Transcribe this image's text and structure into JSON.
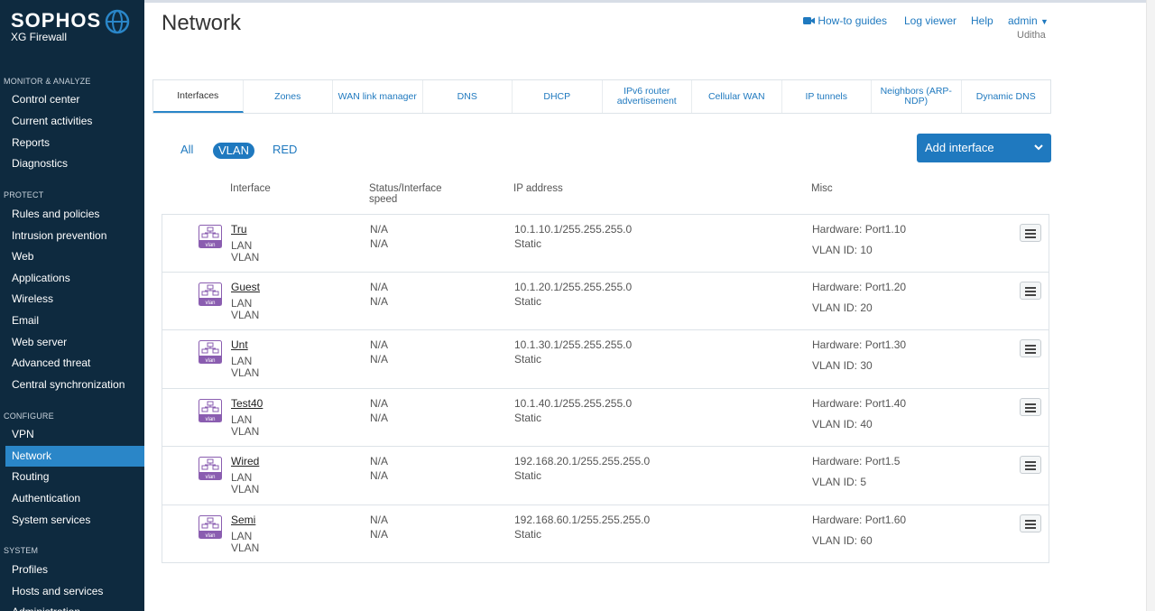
{
  "brand": {
    "name": "SOPHOS",
    "product": "XG Firewall"
  },
  "sidebar": {
    "sections": [
      {
        "label": "MONITOR & ANALYZE",
        "items": [
          "Control center",
          "Current activities",
          "Reports",
          "Diagnostics"
        ]
      },
      {
        "label": "PROTECT",
        "items": [
          "Rules and policies",
          "Intrusion prevention",
          "Web",
          "Applications",
          "Wireless",
          "Email",
          "Web server",
          "Advanced threat",
          "Central synchronization"
        ]
      },
      {
        "label": "CONFIGURE",
        "items": [
          "VPN",
          "Network",
          "Routing",
          "Authentication",
          "System services"
        ]
      },
      {
        "label": "SYSTEM",
        "items": [
          "Profiles",
          "Hosts and services",
          "Administration"
        ]
      }
    ],
    "active_item": "Network"
  },
  "header": {
    "title": "Network",
    "links": {
      "guides": "How-to guides",
      "log": "Log viewer",
      "help": "Help",
      "admin": "admin"
    },
    "user": "Uditha"
  },
  "tabs": [
    "Interfaces",
    "Zones",
    "WAN link manager",
    "DNS",
    "DHCP",
    "IPv6 router advertisement",
    "Cellular WAN",
    "IP tunnels",
    "Neighbors (ARP-NDP)",
    "Dynamic DNS"
  ],
  "active_tab": "Interfaces",
  "filters": {
    "all": "All",
    "vlan": "VLAN",
    "red": "RED",
    "active": "VLAN"
  },
  "add_button": {
    "label": "Add interface"
  },
  "columns": {
    "interface": "Interface",
    "status": "Status/Interface speed",
    "ip": "IP address",
    "misc": "Misc"
  },
  "rows": [
    {
      "name": "Tru",
      "zone": "LAN",
      "type": "VLAN",
      "status": "N/A",
      "speed": "N/A",
      "ip": "10.1.10.1/255.255.255.0",
      "mode": "Static",
      "hardware": "Hardware:  Port1.10",
      "vlan_id": "VLAN ID: 10",
      "icon_label": "vlan"
    },
    {
      "name": "Guest",
      "zone": "LAN",
      "type": "VLAN",
      "status": "N/A",
      "speed": "N/A",
      "ip": "10.1.20.1/255.255.255.0",
      "mode": "Static",
      "hardware": "Hardware:  Port1.20",
      "vlan_id": "VLAN ID: 20",
      "icon_label": "vlan"
    },
    {
      "name": "Unt",
      "zone": "LAN",
      "type": "VLAN",
      "status": "N/A",
      "speed": "N/A",
      "ip": "10.1.30.1/255.255.255.0",
      "mode": "Static",
      "hardware": "Hardware:  Port1.30",
      "vlan_id": "VLAN ID: 30",
      "icon_label": "vlan"
    },
    {
      "name": "Test40",
      "zone": "LAN",
      "type": "VLAN",
      "status": "N/A",
      "speed": "N/A",
      "ip": "10.1.40.1/255.255.255.0",
      "mode": "Static",
      "hardware": "Hardware:  Port1.40",
      "vlan_id": "VLAN ID: 40",
      "icon_label": "vlan"
    },
    {
      "name": "Wired",
      "zone": "LAN",
      "type": "VLAN",
      "status": "N/A",
      "speed": "N/A",
      "ip": "192.168.20.1/255.255.255.0",
      "mode": "Static",
      "hardware": "Hardware:  Port1.5",
      "vlan_id": "VLAN ID: 5",
      "icon_label": "vlan"
    },
    {
      "name": "Semi",
      "zone": "LAN",
      "type": "VLAN",
      "status": "N/A",
      "speed": "N/A",
      "ip": "192.168.60.1/255.255.255.0",
      "mode": "Static",
      "hardware": "Hardware:  Port1.60",
      "vlan_id": "VLAN ID: 60",
      "icon_label": "vlan"
    }
  ],
  "colors": {
    "sidebar_bg": "#0e2a3f",
    "accent": "#1f79bf",
    "active_nav": "#2a86c8",
    "vlan_icon": "#8a5db0"
  }
}
